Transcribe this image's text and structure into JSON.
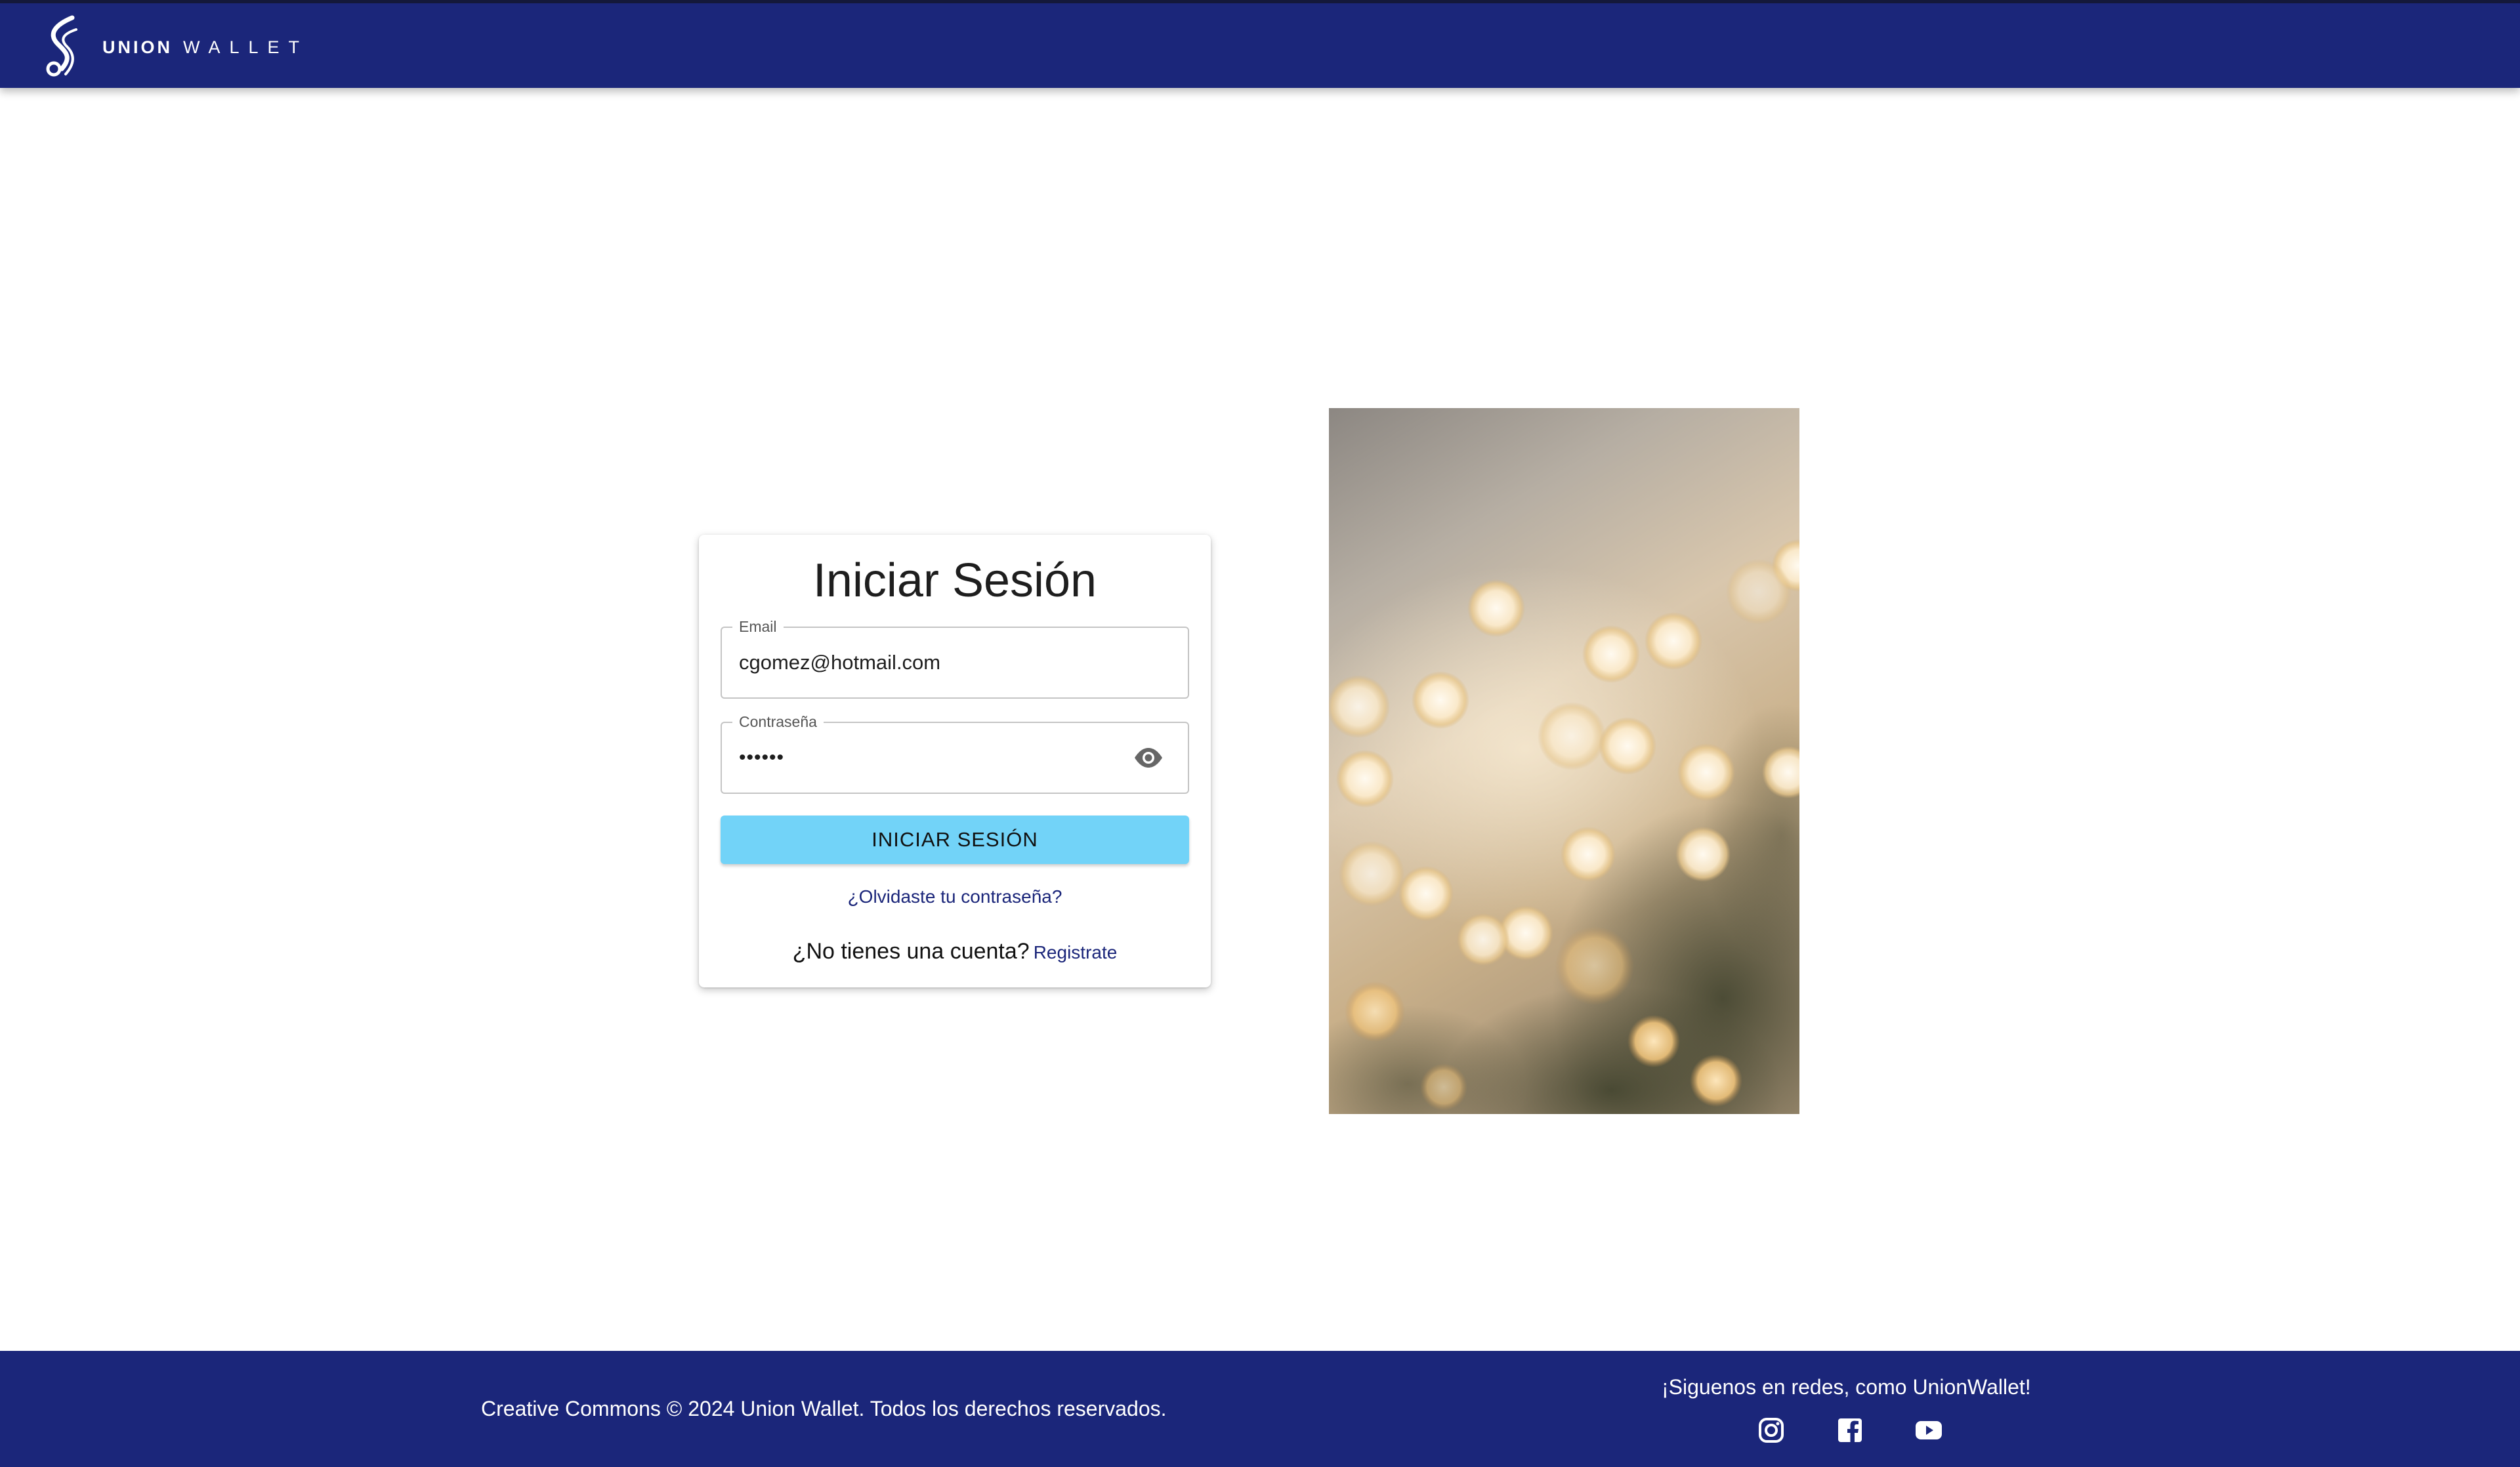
{
  "header": {
    "brand_strong": "UNION",
    "brand_light": "WALLET",
    "logo_icon": "union-wallet-s-icon"
  },
  "login": {
    "title": "Iniciar Sesión",
    "email_label": "Email",
    "email_value": "cgomez@hotmail.com",
    "password_label": "Contraseña",
    "password_value": "••••••",
    "password_toggle_icon": "eye-icon",
    "submit_label": "INICIAR SESIÓN",
    "forgot_label": "¿Olvidaste tu contraseña?",
    "no_account_text": "¿No tienes una cuenta?",
    "register_label": "Registrate"
  },
  "footer": {
    "copyright": "Creative Commons © 2024 Union Wallet. Todos los derechos reservados.",
    "follow_text": "¡Siguenos en redes, como UnionWallet!",
    "social_icons": [
      "instagram-icon",
      "facebook-icon",
      "youtube-icon"
    ]
  },
  "colors": {
    "brand_navy": "#1b267a",
    "button_cyan": "#72d3f8",
    "link": "#1b267a"
  }
}
